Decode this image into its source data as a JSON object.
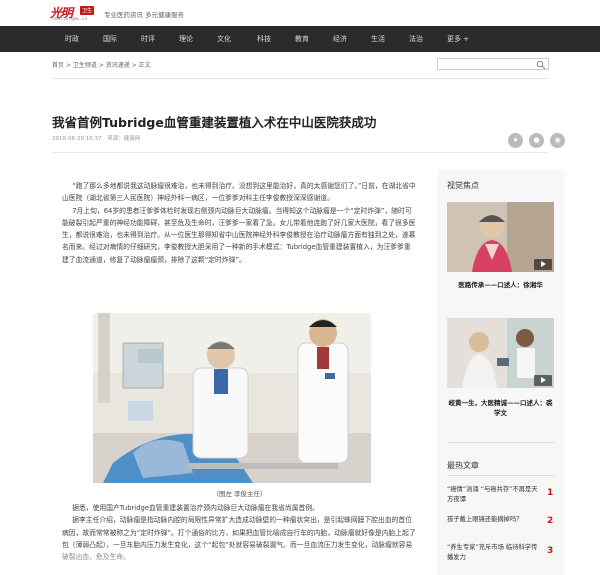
{
  "header": {
    "logo_text": "光明",
    "logo_badge": "卫生",
    "logo_sub": "health.gmw.cn",
    "slogan": "专业医药资讯 多元健康服务"
  },
  "nav": [
    "时政",
    "国际",
    "时评",
    "理论",
    "文化",
    "科技",
    "教育",
    "经济",
    "生活",
    "法治",
    "更多 +"
  ],
  "breadcrumb": [
    "首页",
    "卫生频道",
    "资讯速递",
    "正文"
  ],
  "article": {
    "title": "我省首例Tubridge血管重建装置植入术在中山医院获成功",
    "date": "2018-08-20 16:37",
    "source": "来源：健康网",
    "paragraphs": [
      "“跑了那么多地都说我这动脉瘤很难治，也未得到治疗。没想到这里能治好，真的太感谢您们了。”日前，在湖北省中山医院（湖北省第三人民医院）神经外科一病区，一位爹爹对科主任李俊教授深深感谢道。",
      "7月上旬，64岁的患者汪爹爹体检时发现右侧颈内动脉巨大动脉瘤。当得知这个动脉瘤是一个“定时炸弹”，随时可能破裂引起严重的神经功能障碍，甚至危及生命时，汪爹爹一家着了急。女儿带着他连跑了好几家大医院，看了很多医生，都说很难治，也未得到治疗。从一位医生那得知省中山医院神经外科李俊教授在治疗动脉瘤方面有独到之处，遂慕名而来。经过对病情的仔细研究，李俊教授大胆采用了一种新的手术模式：Tubridge血管重建装置植入，为汪爹爹重建了血流通道，修复了动脉瘤瘤颈，排除了这颗“定时炸弹”。"
    ],
    "caption": "（图左 李俊主任）",
    "paragraphs2": [
      "据悉，使用国产Tubridge血管重建装置治疗颈内动脉巨大动脉瘤在我省尚属首例。",
      "据李主任介绍，动脉瘤是指动脉内腔的局限性异常扩大造成动脉壁的一种瘤状突出，是引起蛛网膜下腔出血的首位病因，故而常常被称之为“定时炸弹”。打个通俗的比方，如果把血管比喻成自行车的内胎，动脉瘤就好像是内胎上起了包（薄弱凸起），一旦车胎内压力发生变化，这个“起包”处就容易破裂漏气。而一旦血流压力发生变化，动脉瘤就容易破裂出血，危及生命。"
    ]
  },
  "sidebar": {
    "video_heading": "视觉焦点",
    "videos": [
      {
        "caption": "医路传承——口述人：徐湘华"
      },
      {
        "caption": "岐黄一生，大医精诚——口述人：裘学文"
      }
    ],
    "hot_heading": "最热文章",
    "hot": [
      {
        "title": "“癌情”汹涌 “与癌共存”不再是天方夜谭",
        "rank": "1"
      },
      {
        "title": "孩子戴上眼镜还能摘掉吗？",
        "rank": "2"
      },
      {
        "title": "“养生专家”充斥市场 临待科学传播发力",
        "rank": "3"
      }
    ]
  }
}
